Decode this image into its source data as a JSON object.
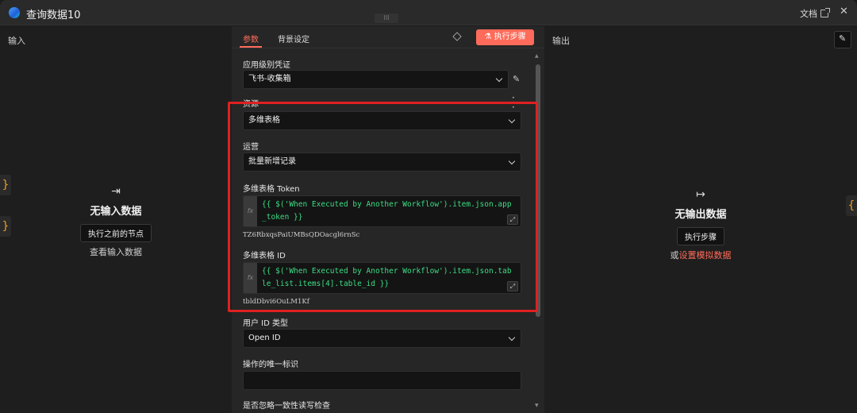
{
  "titlebar": {
    "title": "查询数据10",
    "grip_label": "III",
    "docs_label": "文档",
    "close_glyph": "✕"
  },
  "input_panel": {
    "label": "输入",
    "brace_glyph": "}",
    "arrow_glyph": "⇥",
    "empty_title": "无输入数据",
    "prev_nodes_button": "执行之前的节点",
    "view_input_link": "查看输入数据"
  },
  "output_panel": {
    "label": "输出",
    "brace_glyph": "{",
    "arrow_glyph": "↦",
    "empty_title": "无输出数据",
    "run_step_button": "执行步骤",
    "or_text": "或",
    "mock_link": "设置模拟数据",
    "edit_glyph": "✎"
  },
  "params": {
    "tabs": [
      {
        "label": "参数"
      },
      {
        "label": "背景设定"
      }
    ],
    "run_button": "执行步骤",
    "credential": {
      "label": "应用级别凭证",
      "value": "飞书-收集箱"
    },
    "resource": {
      "label": "资源",
      "value": "多维表格"
    },
    "operation": {
      "label": "运营",
      "value": "批量新增记录"
    },
    "token": {
      "label": "多维表格 Token",
      "expression": "{{ $('When Executed by Another Workflow').item.json.app_token }}",
      "result": "TZ6RbxqsPaiUMBsQDOacgl6rnSc"
    },
    "table_id": {
      "label": "多维表格 ID",
      "expression": "{{ $('When Executed by Another Workflow').item.json.table_list.items[4].table_id }}",
      "result": "tbldDbvi6OuLM1Kf"
    },
    "user_id_type": {
      "label": "用户 ID 类型",
      "value": "Open ID"
    },
    "unique_id": {
      "label": "操作的唯一标识",
      "value": ""
    },
    "ignore_consistency": {
      "label": "是否忽略一致性读写检查"
    },
    "fx_label": "fx",
    "expand_glyph": "⤢"
  },
  "colors": {
    "accent": "#ff6b5a",
    "highlight_border": "#e02020",
    "expression_text": "#3ddc84"
  }
}
